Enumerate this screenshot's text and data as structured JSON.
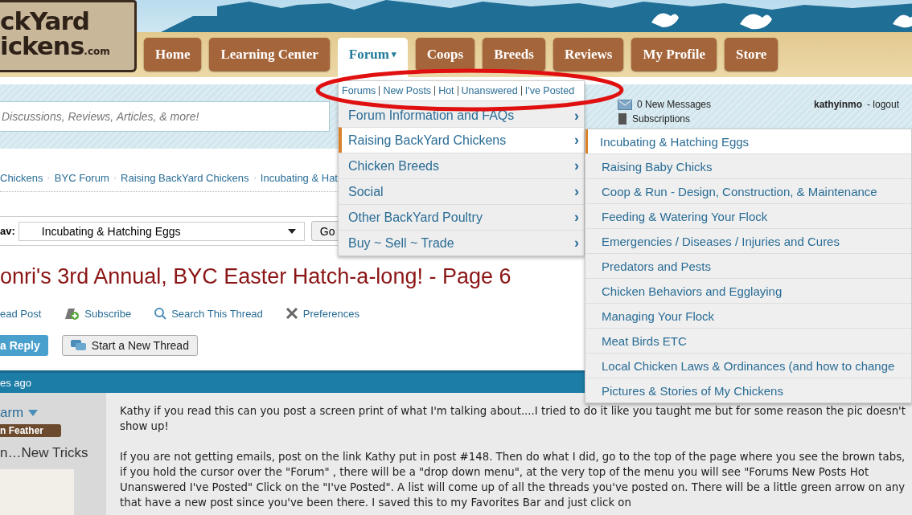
{
  "logo": {
    "line_1": "ckYard",
    "line_2": "ickens",
    "suffix": ".com"
  },
  "nav_tabs": [
    {
      "label": "Home",
      "selected": false
    },
    {
      "label": "Learning Center",
      "selected": false
    },
    {
      "label": "Forum",
      "selected": true,
      "caret": "▾"
    },
    {
      "label": "Coops",
      "selected": false
    },
    {
      "label": "Breeds",
      "selected": false
    },
    {
      "label": "Reviews",
      "selected": false
    },
    {
      "label": "My Profile",
      "selected": false
    },
    {
      "label": "Store",
      "selected": false
    }
  ],
  "search": {
    "placeholder": "Discussions, Reviews, Articles, & more!"
  },
  "user_panel": {
    "messages": "0 New Messages",
    "subscriptions": "Subscriptions",
    "username": "kathyinmo",
    "logout": "- logout"
  },
  "breadcrumb": [
    "Chickens",
    "BYC Forum",
    "Raising BackYard Chickens",
    "Incubating & Hat"
  ],
  "forum_nav": {
    "label": "av:",
    "value": "Incubating & Hatching Eggs",
    "button": "Go"
  },
  "thread_title": "onri's 3rd Annual, BYC Easter Hatch-a-long! - Page 6",
  "thread_actions": [
    {
      "label": "ead Post",
      "kind": "plain"
    },
    {
      "label": "Subscribe",
      "kind": "subscribe"
    },
    {
      "label": "Search This Thread",
      "kind": "search"
    },
    {
      "label": "Preferences",
      "kind": "preferences"
    }
  ],
  "buttons": [
    {
      "label": "a Reply",
      "kind": "primary"
    },
    {
      "label": "Start a New Thread",
      "kind": "new-thread"
    }
  ],
  "post": {
    "time": "es ago",
    "author": "arm",
    "rank": "n Feather",
    "user_title": "n…New Tricks",
    "paragraphs": [
      "Kathy if you read this can you post a screen print of what I'm talking about....I tried to do it like you taught me but for some reason the pic doesn't show up!",
      "If you are not getting emails, post on the link Kathy put in post #148.  Then do what I did, go to the top of the page where you see the brown tabs, if you hold the cursor over the \"Forum\" , there will be a \"drop down menu\", at the very top of the menu you will see \"Forums   New Posts  Hot  Unanswered  I've Posted\"   Click on the \"I've Posted\".  A list will come up of all the threads you've posted on.  There will be a little green arrow on any that have a new post since you've been there.  I saved this to my Favorites Bar and just click on"
    ]
  },
  "forum_menu": {
    "quick_links": [
      "Forums",
      "New Posts",
      "Hot",
      "Unanswered",
      "I've Posted"
    ],
    "items": [
      {
        "label": "Forum Information and FAQs",
        "selected": false,
        "arrow": "›"
      },
      {
        "label": "Raising BackYard Chickens",
        "selected": true,
        "arrow": "›"
      },
      {
        "label": "Chicken Breeds",
        "selected": false,
        "arrow": "›"
      },
      {
        "label": "Social",
        "selected": false,
        "arrow": "›"
      },
      {
        "label": "Other BackYard Poultry",
        "selected": false,
        "arrow": "›"
      },
      {
        "label": "Buy ~ Sell ~ Trade",
        "selected": false,
        "arrow": "›"
      }
    ]
  },
  "submenu": {
    "items": [
      {
        "label": "Incubating & Hatching Eggs",
        "selected": true
      },
      {
        "label": "Raising Baby Chicks",
        "selected": false
      },
      {
        "label": "Coop & Run - Design, Construction, & Maintenance",
        "selected": false
      },
      {
        "label": "Feeding & Watering Your Flock",
        "selected": false
      },
      {
        "label": "Emergencies / Diseases / Injuries and Cures",
        "selected": false
      },
      {
        "label": "Predators and Pests",
        "selected": false
      },
      {
        "label": "Chicken Behaviors and Egglaying",
        "selected": false
      },
      {
        "label": "Managing Your Flock",
        "selected": false
      },
      {
        "label": "Meat Birds ETC",
        "selected": false
      },
      {
        "label": "Local Chicken Laws & Ordinances (and how to change",
        "selected": false
      },
      {
        "label": "Pictures & Stories of My Chickens",
        "selected": false
      }
    ]
  }
}
